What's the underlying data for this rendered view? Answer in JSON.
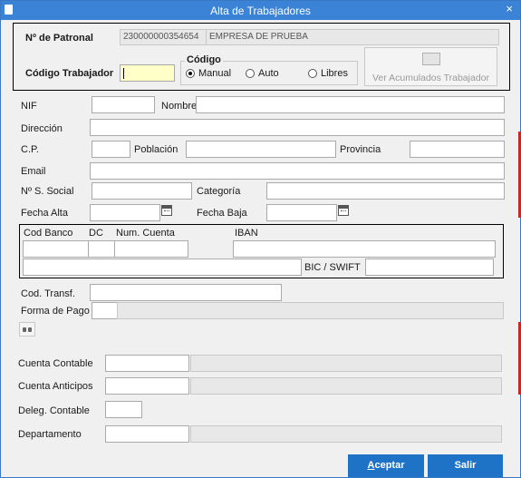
{
  "window": {
    "title": "Alta de Trabajadores",
    "close_label": "×"
  },
  "patronal": {
    "label": "Nº de Patronal",
    "number": "230000000354654",
    "company": "EMPRESA DE PRUEBA"
  },
  "codigo_trabajador": {
    "label": "Código Trabajador",
    "value": ""
  },
  "codigo": {
    "legend": "Código",
    "options": [
      "Manual",
      "Auto",
      "Libres"
    ],
    "selected": "Manual"
  },
  "ver_acumulados": {
    "label": "Ver Acumulados Trabajador"
  },
  "fields": {
    "nif": "NIF",
    "nombre": "Nombre",
    "direccion": "Dirección",
    "cp": "C.P.",
    "poblacion": "Población",
    "provincia": "Provincia",
    "email": "Email",
    "ss": "Nº S. Social",
    "categoria": "Categoría",
    "fecha_alta": "Fecha Alta",
    "fecha_baja": "Fecha Baja"
  },
  "banco": {
    "cod_banco": "Cod Banco",
    "dc": "DC",
    "num_cuenta": "Num. Cuenta",
    "iban": "IBAN",
    "bic": "BIC / SWIFT"
  },
  "cod_transf": "Cod. Transf.",
  "forma_pago": "Forma de Pago",
  "contable": {
    "cuenta_contable": "Cuenta Contable",
    "cuenta_anticipos": "Cuenta Anticipos",
    "deleg_contable": "Deleg. Contable",
    "departamento": "Departamento"
  },
  "buttons": {
    "aceptar_first": "A",
    "aceptar_rest": "ceptar",
    "salir": "Salir"
  },
  "icons": {
    "binoculars": "binoculars-icon",
    "calendar": "calendar-icon"
  }
}
